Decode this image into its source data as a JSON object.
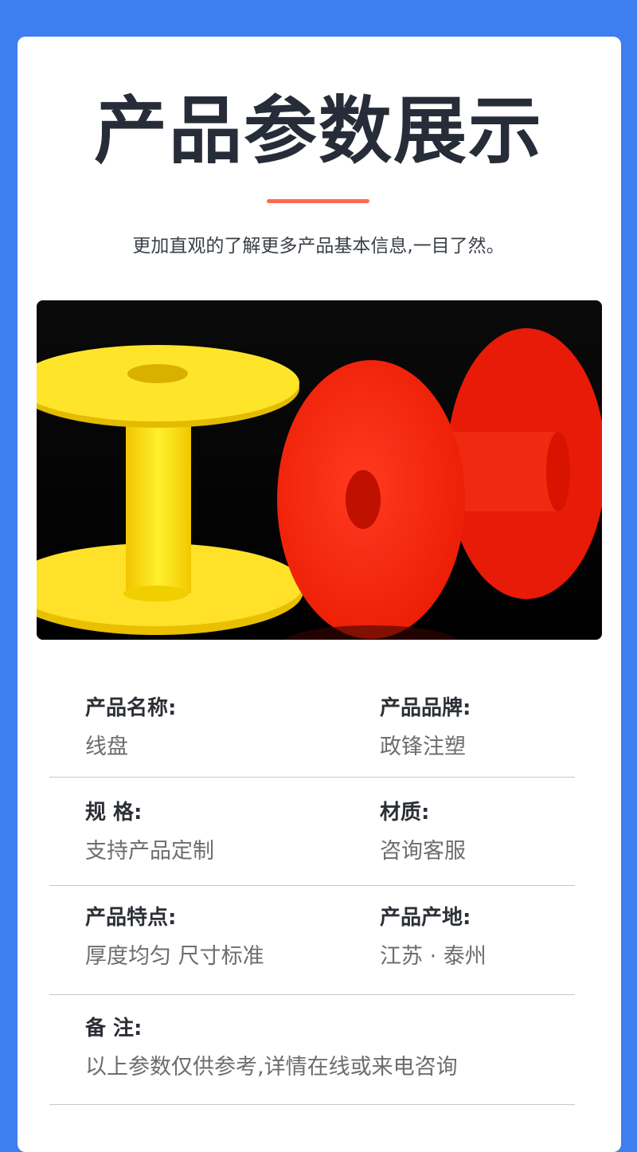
{
  "page": {
    "title": "产品参数展示",
    "subtitle": "更加直观的了解更多产品基本信息,一目了然。",
    "accent_color": "#ff6a4a",
    "background_color": "#3d7ef0"
  },
  "product_image": {
    "subject": "product-photo-spools",
    "colors": [
      "#ffe12a",
      "#ff2a12"
    ]
  },
  "specs": {
    "name_label": "产品名称:",
    "name_value": "线盘",
    "brand_label": "产品品牌:",
    "brand_value": "政锋注塑",
    "size_label": "规 格:",
    "size_value": "支持产品定制",
    "material_label": "材质:",
    "material_value": "咨询客服",
    "feature_label": "产品特点:",
    "feature_value": "厚度均匀 尺寸标准",
    "origin_label": "产品产地:",
    "origin_value": "江苏 · 泰州",
    "note_label": "备 注:",
    "note_value": "以上参数仅供参考,详情在线或来电咨询"
  }
}
